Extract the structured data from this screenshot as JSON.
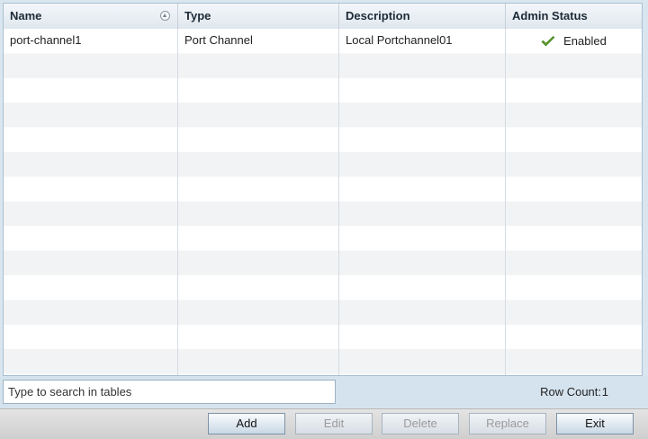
{
  "table": {
    "columns": [
      {
        "key": "name",
        "label": "Name"
      },
      {
        "key": "type",
        "label": "Type"
      },
      {
        "key": "description",
        "label": "Description"
      },
      {
        "key": "admin_status",
        "label": "Admin Status"
      }
    ],
    "rows": [
      {
        "name": "port-channel1",
        "type": "Port Channel",
        "description": "Local Portchannel01",
        "admin_status": "Enabled",
        "admin_status_icon": "checkmark-icon"
      }
    ]
  },
  "search": {
    "placeholder": "Type to search in tables"
  },
  "row_count": {
    "label": "Row Count:",
    "value": "1"
  },
  "buttons": {
    "add": "Add",
    "edit": "Edit",
    "delete": "Delete",
    "replace": "Replace",
    "exit": "Exit"
  },
  "colors": {
    "status_ok": "#5aa02c"
  }
}
